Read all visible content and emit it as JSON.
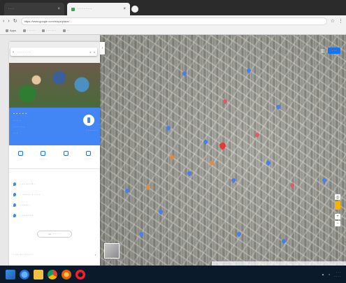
{
  "browser": {
    "tabs": [
      {
        "label": "· · ·",
        "active": false
      },
      {
        "label": "· · · · · · ·",
        "active": true
      }
    ],
    "url": "https://www.google.com/maps/place/...",
    "bookmarks": [
      "Apps",
      "· · · · ·",
      "· · · · · ·",
      "· ·"
    ]
  },
  "sidebar": {
    "search_value": "· · · · · · · · ·",
    "place": {
      "title": "· · · · ·",
      "subtitle": "· · · · ·",
      "rating": "· · · · · · ·",
      "type": "· · ·",
      "directions_label": "· · · · · · ·"
    },
    "actions": [
      {
        "label": "· · ·",
        "icon": "save-icon"
      },
      {
        "label": "· · · · ·",
        "icon": "nearby-icon"
      },
      {
        "label": "· · · · ·",
        "icon": "phone-icon"
      },
      {
        "label": "· · · · ·",
        "icon": "share-icon"
      }
    ],
    "info_rows": [
      {
        "text": "· · · · · · · · ·",
        "icon": "location-icon"
      },
      {
        "text": "· · · · · · · · · · · ·",
        "icon": "pluscode-icon"
      },
      {
        "text": "· · · · · ·",
        "icon": "phone-icon"
      },
      {
        "text": "· · · · · · · ·",
        "icon": "label-icon"
      }
    ],
    "add_label_button": "· · · · · ·",
    "missing_info": "· · · · · · · · · · ·"
  },
  "map": {
    "signin_label": "· · ·",
    "main_pin_color": "#e53935",
    "pin_color_blue": "#4a7ee8",
    "footer_text": "· · · · · · · · · · · · · · · · · · · ·"
  },
  "taskbar": {
    "time": "· · ·",
    "date": "· · · ·"
  }
}
